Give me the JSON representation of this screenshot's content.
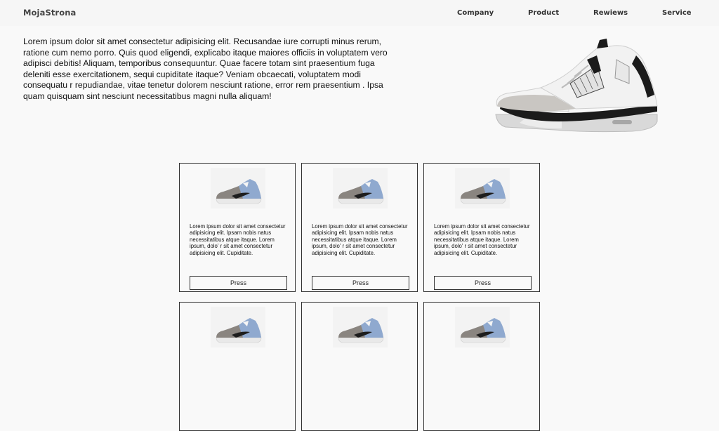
{
  "nav": {
    "logo": "MojaStrona",
    "links": [
      "Company",
      "Product",
      "Rewiews",
      "Service"
    ]
  },
  "hero": {
    "text": "Lorem ipsum dolor sit amet consectetur adipisicing elit. Recusandae iure corrupti minus rerum, ratione cum nemo porro. Quis quod eligendi, explicabo itaque maiores officiis in voluptatem vero adipisci debitis! Aliquam, temporibus consequuntur. Quae facere totam sint praesentium fuga deleniti esse exercitationem, sequi cupiditate itaque? Veniam obcaecati, voluptatem modi consequatu r repudiandae, vitae tenetur dolorem nesciunt ratione, error rem praesentium . Ipsa quam quisquam sint nesciunt necessitatibus magni nulla aliquam!",
    "image_icon": "sneaker-icon"
  },
  "cards": [
    {
      "text": "Lorem ipsum dolor sit amet consectetur adipisicing elit. Ipsam nobis natus necessitatibus atque itaque. Lorem ipsum, dolo' r sit amet consectetur adipisicing elit. Cupiditate.",
      "button": "Press"
    },
    {
      "text": "Lorem ipsum dolor sit amet consectetur adipisicing elit. Ipsam nobis natus necessitatibus atque itaque. Lorem ipsum, dolo' r sit amet consectetur adipisicing elit. Cupiditate.",
      "button": "Press"
    },
    {
      "text": "Lorem ipsum dolor sit amet consectetur adipisicing elit. Ipsam nobis natus necessitatibus atque itaque. Lorem ipsum, dolo' r sit amet consectetur adipisicing elit. Cupiditate.",
      "button": "Press"
    },
    {
      "text": "",
      "button": ""
    },
    {
      "text": "",
      "button": ""
    },
    {
      "text": "",
      "button": ""
    }
  ],
  "colors": {
    "background": "#f9f9f9",
    "nav_background": "#f6f6f6",
    "border": "#333333",
    "shoe_blue": "#8fa9cf",
    "shoe_grey": "#8a8580"
  }
}
